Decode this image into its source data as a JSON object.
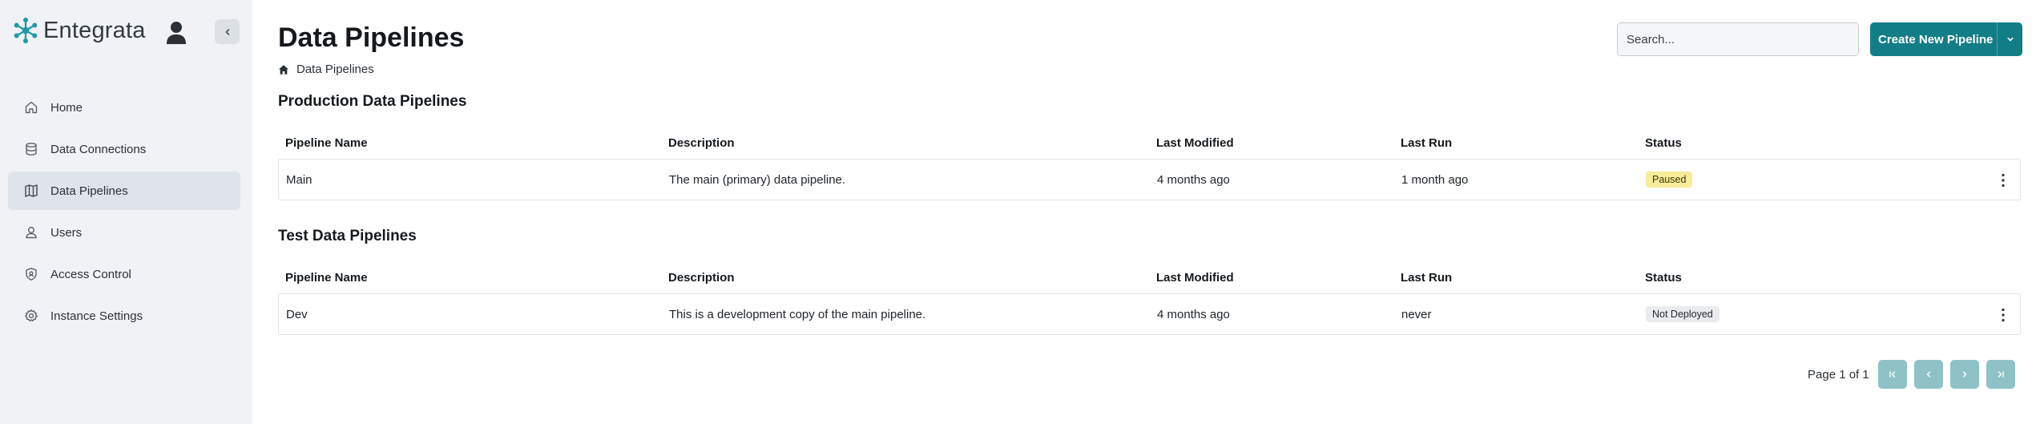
{
  "app": {
    "brand_name": "Entegrata"
  },
  "sidebar": {
    "items": [
      {
        "label": "Home",
        "icon": "home-icon",
        "active": false
      },
      {
        "label": "Data Connections",
        "icon": "database-icon",
        "active": false
      },
      {
        "label": "Data Pipelines",
        "icon": "map-icon",
        "active": true
      },
      {
        "label": "Users",
        "icon": "user-icon",
        "active": false
      },
      {
        "label": "Access Control",
        "icon": "shield-icon",
        "active": false
      },
      {
        "label": "Instance Settings",
        "icon": "gear-icon",
        "active": false
      }
    ]
  },
  "header": {
    "title": "Data Pipelines",
    "breadcrumb": "Data Pipelines",
    "search_placeholder": "Search...",
    "create_label": "Create New Pipeline"
  },
  "columns": {
    "name": "Pipeline Name",
    "description": "Description",
    "last_modified": "Last Modified",
    "last_run": "Last Run",
    "status": "Status"
  },
  "production": {
    "title": "Production Data Pipelines",
    "rows": [
      {
        "name": "Main",
        "description": "The main (primary) data pipeline.",
        "last_modified": "4 months ago",
        "last_run": "1 month ago",
        "status": "Paused"
      }
    ]
  },
  "test": {
    "title": "Test Data Pipelines",
    "rows": [
      {
        "name": "Dev",
        "description": "This is a development copy of the main pipeline.",
        "last_modified": "4 months ago",
        "last_run": "never",
        "status": "Not Deployed"
      }
    ]
  },
  "pagination": {
    "info": "Page 1 of 1"
  },
  "colors": {
    "accent": "#137d86",
    "accent_disabled": "#8ec2c7",
    "sidebar_bg": "#f0f2f5",
    "badge_paused": "#f7ec9a",
    "badge_not_deployed": "#e9ebee"
  }
}
